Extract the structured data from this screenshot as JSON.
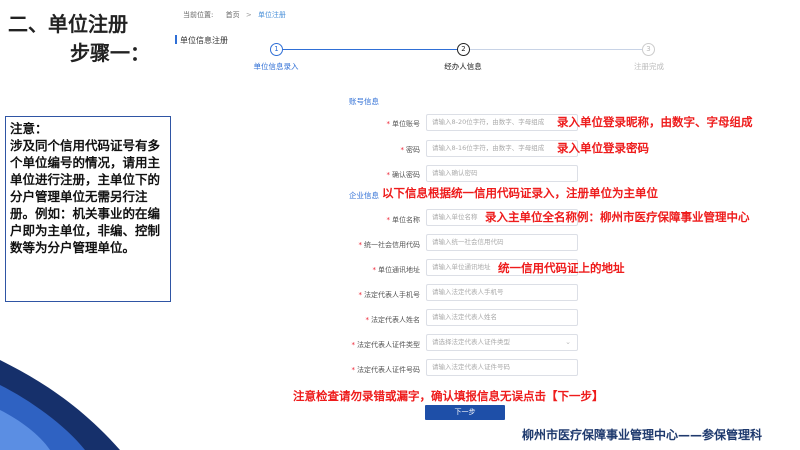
{
  "left": {
    "title_line1": "二、单位注册",
    "title_line2": "步骤一：",
    "note_title": "注意：",
    "note_body": "涉及同个信用代码证号有多个单位编号的情况，请用主单位进行注册，主单位下的分户管理单位无需另行注册。例如：机关事业的在编户即为主单位，非编、控制数等为分户管理单位。"
  },
  "breadcrumb": {
    "prefix": "当前位置:",
    "home": "首页",
    "sep": ">",
    "current": "单位注册"
  },
  "section_label": "单位信息注册",
  "steps": [
    {
      "number": "1",
      "label": "单位信息录入",
      "state": "done"
    },
    {
      "number": "2",
      "label": "经办人信息",
      "state": "active"
    },
    {
      "number": "3",
      "label": "注册完成",
      "state": "pending"
    }
  ],
  "form": {
    "account_group": "账号信息",
    "company_group": "企业信息",
    "fields": [
      {
        "label": "单位账号",
        "placeholder": "请输入8-20位字符，由数字、字母组成"
      },
      {
        "label": "密码",
        "placeholder": "请输入8-16位字符，由数字、字母组成"
      },
      {
        "label": "确认密码",
        "placeholder": "请输入确认密码"
      },
      {
        "label": "单位名称",
        "placeholder": "请输入单位名称"
      },
      {
        "label": "统一社会信用代码",
        "placeholder": "请输入统一社会信用代码"
      },
      {
        "label": "单位通讯地址",
        "placeholder": "请输入单位通讯地址"
      },
      {
        "label": "法定代表人手机号",
        "placeholder": "请输入法定代表人手机号"
      },
      {
        "label": "法定代表人姓名",
        "placeholder": "请输入法定代表人姓名"
      },
      {
        "label": "法定代表人证件类型",
        "placeholder": "请选择法定代表人证件类型"
      },
      {
        "label": "法定代表人证件号码",
        "placeholder": "请输入法定代表人证件号码"
      }
    ],
    "next_label": "下一步"
  },
  "annotations": {
    "account": "录入单位登录昵称，由数字、字母组成",
    "password": "录入单位登录密码",
    "company_info": "以下信息根据统一信用代码证录入，注册单位为主单位",
    "company_name": "录入主单位全名称例：柳州市医疗保障事业管理中心",
    "address": "统一信用代码证上的地址",
    "check": "注意检查请勿录错或漏字，确认填报信息无误点击【下一步】"
  },
  "footer": "柳州市医疗保障事业管理中心——参保管理科",
  "colors": {
    "accent": "#2f6fd6",
    "annotation_red": "#ee1c1c",
    "button_blue": "#1e4fa8",
    "footer_navy": "#1f3a6e"
  }
}
